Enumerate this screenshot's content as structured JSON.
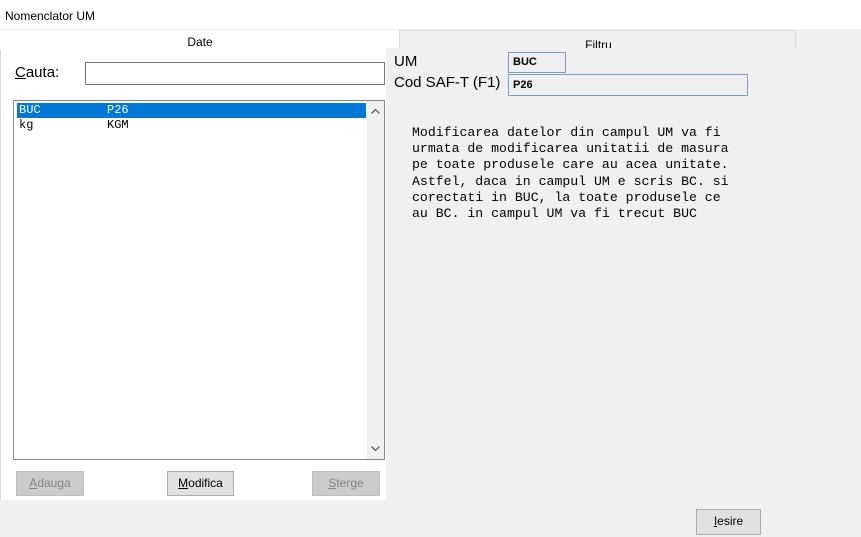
{
  "window": {
    "title": "Nomenclator UM"
  },
  "tabs": [
    {
      "label": "Date"
    },
    {
      "label": "Filtru"
    }
  ],
  "search": {
    "label_hotkey": "C",
    "label_rest": "auta:",
    "value": ""
  },
  "list": {
    "rows": [
      {
        "um": "BUC",
        "code": "P26",
        "selected": true
      },
      {
        "um": "kg",
        "code": "KGM",
        "selected": false
      }
    ]
  },
  "buttons": {
    "add": {
      "hotkey": "A",
      "rest": "dauga"
    },
    "modify": {
      "hotkey": "M",
      "rest": "odifica"
    },
    "delete": {
      "hotkey": "S",
      "rest": "terge"
    },
    "exit": {
      "hotkey": "I",
      "rest": "esire"
    }
  },
  "detail": {
    "um_label": "UM",
    "um_value": "BUC",
    "saft_label": "Cod SAF-T (F1)",
    "saft_value": "P26"
  },
  "note": "Modificarea datelor din campul UM va fi\nurmata de modificarea unitatii de masura\npe toate produsele care au acea unitate.\nAstfel, daca in campul UM e scris BC. si\ncorectati in BUC, la toate produsele ce\nau BC. in campul UM va fi trecut BUC",
  "colors": {
    "selection": "#0078d7",
    "field_border": "#7a9cc4"
  }
}
